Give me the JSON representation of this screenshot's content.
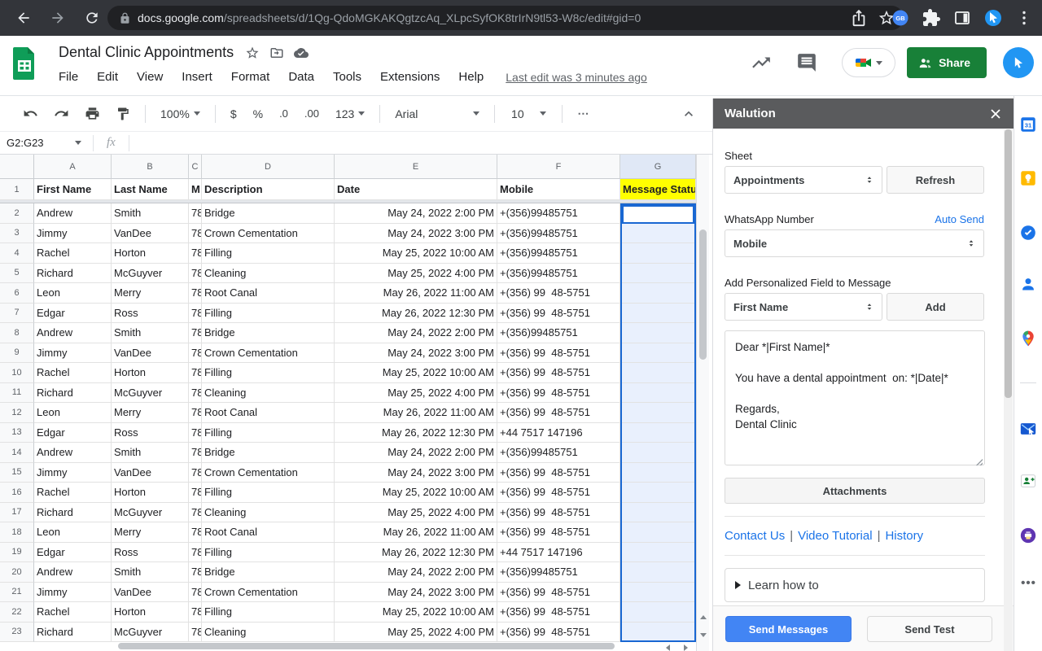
{
  "browser": {
    "url_host": "docs.google.com",
    "url_path": "/spreadsheets/d/1Qg-QdoMGKAKQgtzcAq_XLpcSyfOK8trIrN9tl53-W8c/edit#gid=0"
  },
  "app_header": {
    "title": "Dental Clinic Appointments",
    "menu_items": [
      "File",
      "Edit",
      "View",
      "Insert",
      "Format",
      "Data",
      "Tools",
      "Extensions",
      "Help"
    ],
    "last_edit": "Last edit was 3 minutes ago",
    "share_label": "Share"
  },
  "toolbar": {
    "zoom": "100%",
    "currency": "$",
    "percent": "%",
    "decrease_decimal": ".0",
    "increase_decimal": ".00",
    "number_format": "123",
    "font_name": "Arial",
    "font_size": "10",
    "more": "⋯"
  },
  "formula_bar": {
    "name_box": "G2:G23",
    "fx_label": "fx"
  },
  "sheet": {
    "column_letters": [
      "A",
      "B",
      "C",
      "D",
      "E",
      "F",
      "G"
    ],
    "header_row": {
      "n": "1",
      "cells": [
        "First Name",
        "Last Name",
        "M",
        "Description",
        "Date",
        "Mobile",
        "Message Status"
      ]
    },
    "rows": [
      {
        "n": "2",
        "first": "Andrew",
        "last": "Smith",
        "c": "78",
        "desc": "Bridge",
        "date": "May 24, 2022 2:00 PM",
        "mobile": "+(356)99485751"
      },
      {
        "n": "3",
        "first": "Jimmy",
        "last": "VanDee",
        "c": "78",
        "desc": "Crown Cementation",
        "date": "May 24, 2022 3:00 PM",
        "mobile": "+(356)99485751"
      },
      {
        "n": "4",
        "first": "Rachel",
        "last": "Horton",
        "c": "78",
        "desc": "Filling",
        "date": "May 25, 2022 10:00 AM",
        "mobile": "+(356)99485751"
      },
      {
        "n": "5",
        "first": "Richard",
        "last": "McGuyver",
        "c": "78",
        "desc": "Cleaning",
        "date": "May 25, 2022 4:00 PM",
        "mobile": "+(356)99485751"
      },
      {
        "n": "6",
        "first": "Leon",
        "last": "Merry",
        "c": "78",
        "desc": "Root Canal",
        "date": "May 26, 2022 11:00 AM",
        "mobile": "+(356) 99  48-5751"
      },
      {
        "n": "7",
        "first": "Edgar",
        "last": "Ross",
        "c": "78",
        "desc": "Filling",
        "date": "May 26, 2022 12:30 PM",
        "mobile": "+(356) 99  48-5751"
      },
      {
        "n": "8",
        "first": "Andrew",
        "last": "Smith",
        "c": "78",
        "desc": "Bridge",
        "date": "May 24, 2022 2:00 PM",
        "mobile": "+(356)99485751"
      },
      {
        "n": "9",
        "first": "Jimmy",
        "last": "VanDee",
        "c": "78",
        "desc": "Crown Cementation",
        "date": "May 24, 2022 3:00 PM",
        "mobile": "+(356) 99  48-5751"
      },
      {
        "n": "10",
        "first": "Rachel",
        "last": "Horton",
        "c": "78",
        "desc": "Filling",
        "date": "May 25, 2022 10:00 AM",
        "mobile": "+(356) 99  48-5751"
      },
      {
        "n": "11",
        "first": "Richard",
        "last": "McGuyver",
        "c": "78",
        "desc": "Cleaning",
        "date": "May 25, 2022 4:00 PM",
        "mobile": "+(356) 99  48-5751"
      },
      {
        "n": "12",
        "first": "Leon",
        "last": "Merry",
        "c": "78",
        "desc": "Root Canal",
        "date": "May 26, 2022 11:00 AM",
        "mobile": "+(356) 99  48-5751"
      },
      {
        "n": "13",
        "first": "Edgar",
        "last": "Ross",
        "c": "78",
        "desc": "Filling",
        "date": "May 26, 2022 12:30 PM",
        "mobile": "+44 7517 147196"
      },
      {
        "n": "14",
        "first": "Andrew",
        "last": "Smith",
        "c": "78",
        "desc": "Bridge",
        "date": "May 24, 2022 2:00 PM",
        "mobile": "+(356)99485751"
      },
      {
        "n": "15",
        "first": "Jimmy",
        "last": "VanDee",
        "c": "78",
        "desc": "Crown Cementation",
        "date": "May 24, 2022 3:00 PM",
        "mobile": "+(356) 99  48-5751"
      },
      {
        "n": "16",
        "first": "Rachel",
        "last": "Horton",
        "c": "78",
        "desc": "Filling",
        "date": "May 25, 2022 10:00 AM",
        "mobile": "+(356) 99  48-5751"
      },
      {
        "n": "17",
        "first": "Richard",
        "last": "McGuyver",
        "c": "78",
        "desc": "Cleaning",
        "date": "May 25, 2022 4:00 PM",
        "mobile": "+(356) 99  48-5751"
      },
      {
        "n": "18",
        "first": "Leon",
        "last": "Merry",
        "c": "78",
        "desc": "Root Canal",
        "date": "May 26, 2022 11:00 AM",
        "mobile": "+(356) 99  48-5751"
      },
      {
        "n": "19",
        "first": "Edgar",
        "last": "Ross",
        "c": "78",
        "desc": "Filling",
        "date": "May 26, 2022 12:30 PM",
        "mobile": "+44 7517 147196"
      },
      {
        "n": "20",
        "first": "Andrew",
        "last": "Smith",
        "c": "78",
        "desc": "Bridge",
        "date": "May 24, 2022 2:00 PM",
        "mobile": "+(356)99485751"
      },
      {
        "n": "21",
        "first": "Jimmy",
        "last": "VanDee",
        "c": "78",
        "desc": "Crown Cementation",
        "date": "May 24, 2022 3:00 PM",
        "mobile": "+(356) 99  48-5751"
      },
      {
        "n": "22",
        "first": "Rachel",
        "last": "Horton",
        "c": "78",
        "desc": "Filling",
        "date": "May 25, 2022 10:00 AM",
        "mobile": "+(356) 99  48-5751"
      },
      {
        "n": "23",
        "first": "Richard",
        "last": "McGuyver",
        "c": "78",
        "desc": "Cleaning",
        "date": "May 25, 2022 4:00 PM",
        "mobile": "+(356) 99  48-5751"
      }
    ],
    "colors": {
      "status_header_highlight": "#ffff00",
      "selection_fill": "#e9f0fd",
      "selection_border": "#1967d2"
    }
  },
  "sidebar": {
    "title": "Walution",
    "sheet_label": "Sheet",
    "sheet_select": "Appointments",
    "refresh_label": "Refresh",
    "whatsapp_label": "WhatsApp Number",
    "auto_send_label": "Auto Send",
    "number_select": "Mobile",
    "personalized_label": "Add Personalized Field to Message",
    "field_select": "First Name",
    "add_label": "Add",
    "message": "Dear *|First Name|*\n\nYou have a dental appointment  on: *|Date|*\n\nRegards,\nDental Clinic",
    "attachments_label": "Attachments",
    "links": [
      "Contact Us",
      "Video Tutorial",
      "History"
    ],
    "learn_label": "Learn how to",
    "send_messages_label": "Send Messages",
    "send_test_label": "Send Test",
    "colors": {
      "primary_button": "#4285f4",
      "link": "#1a73e8",
      "header_bg": "#5a5b5d"
    }
  }
}
